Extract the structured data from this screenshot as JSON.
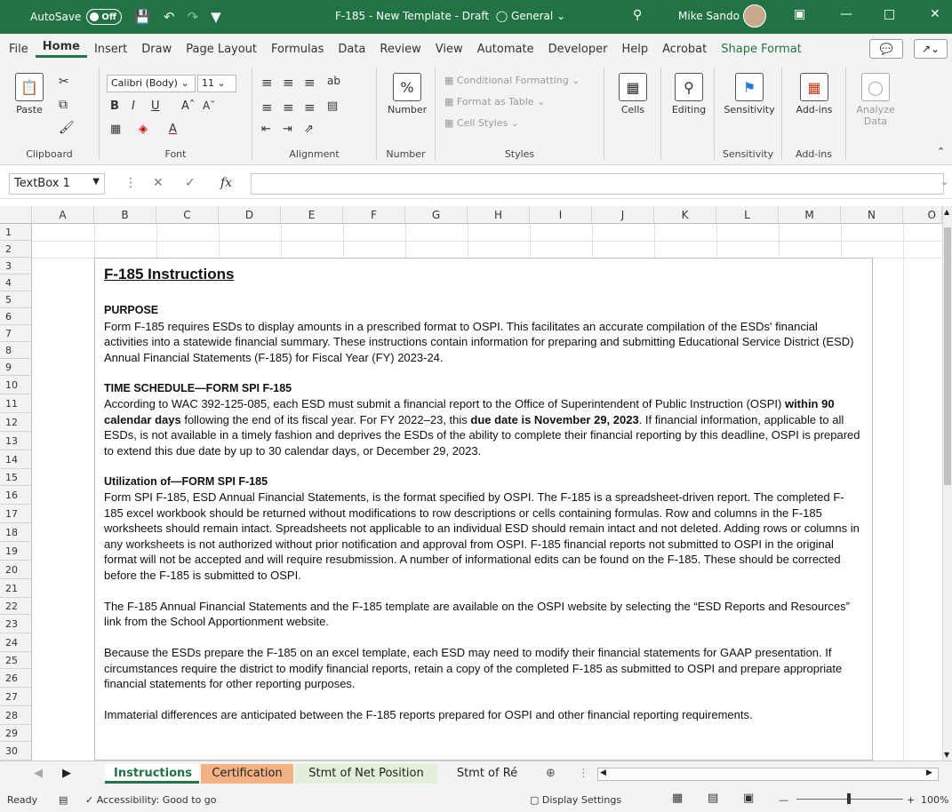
{
  "titlebar": {
    "autosave_label": "AutoSave",
    "autosave_state": "Off",
    "doc_title": "F-185 - New Template - Draft",
    "sensitivity": "General",
    "user": "Mike Sando"
  },
  "menu": {
    "tabs": [
      "File",
      "Home",
      "Insert",
      "Draw",
      "Page Layout",
      "Formulas",
      "Data",
      "Review",
      "View",
      "Automate",
      "Developer",
      "Help",
      "Acrobat",
      "Shape Format"
    ]
  },
  "ribbon": {
    "paste": "Paste",
    "clipboard": "Clipboard",
    "font_name": "Calibri (Body)",
    "font_size": "11",
    "font": "Font",
    "alignment": "Alignment",
    "number": "Number",
    "number_label": "Number",
    "conditional_formatting": "Conditional Formatting",
    "format_as_table": "Format as Table",
    "cell_styles": "Cell Styles",
    "styles": "Styles",
    "cells": "Cells",
    "editing": "Editing",
    "sensitivity": "Sensitivity",
    "sensitivity_group": "Sensitivity",
    "addins": "Add-ins",
    "addins_group": "Add-ins",
    "analyze_data": "Analyze Data"
  },
  "formula_bar": {
    "name_box": "TextBox 1",
    "fx": "fx"
  },
  "grid": {
    "columns": [
      "A",
      "B",
      "C",
      "D",
      "E",
      "F",
      "G",
      "H",
      "I",
      "J",
      "K",
      "L",
      "M",
      "N",
      "O"
    ],
    "rows": [
      "1",
      "2",
      "3",
      "4",
      "5",
      "6",
      "7",
      "8",
      "9",
      "10",
      "11",
      "12",
      "13",
      "14",
      "15",
      "16",
      "17",
      "18",
      "19",
      "20",
      "21",
      "22",
      "23",
      "24",
      "25",
      "26",
      "27",
      "28",
      "29",
      "30"
    ]
  },
  "textbox": {
    "title": "F-185 Instructions",
    "purpose_head": "PURPOSE",
    "purpose_body": "Form F-185 requires ESDs to display amounts in a prescribed format to OSPI. This facilitates an accurate compilation of the ESDs' financial activities into a statewide financial summary. These instructions contain information for preparing and submitting Educational Service District (ESD) Annual Financial Statements (F-185) for Fiscal Year (FY) 2023-24.",
    "schedule_head": "TIME SCHEDULE—FORM SPI F-185",
    "schedule_1": "According to WAC 392-125-085, each ESD must submit a financial report to the Office of Superintendent of Public Instruction (OSPI) ",
    "schedule_b1": "within 90 calendar days",
    "schedule_2": " following the end of its fiscal year. For FY 2022–23, this ",
    "schedule_b2": "due date is November 29, 2023",
    "schedule_3": ". If financial information, applicable to all ESDs, is not available in a timely fashion and deprives the ESDs of the ability to complete their financial reporting by this deadline, OSPI is prepared to extend this due date by up to 30 calendar days, or December 29, 2023.",
    "util_head": "Utilization of—FORM SPI F-185",
    "util_body": "Form SPI F-185, ESD Annual Financial Statements, is the format specified by OSPI. The F-185 is a spreadsheet-driven report. The completed F-185 excel workbook should be returned without modifications to row descriptions or cells containing formulas. Row and columns in the F-185 worksheets should remain intact. Spreadsheets not applicable to an individual ESD should remain intact and not deleted. Adding rows or columns in any worksheets is not authorized without prior notification and approval from OSPI. F-185 financial reports not submitted to OSPI in the original format will not be accepted and will require resubmission. A number of informational edits can be found on the F-185. These should be corrected before the F-185 is submitted to OSPI.",
    "para_website": "The F-185 Annual Financial Statements and the F-185 template are available on the OSPI website by selecting the “ESD Reports and Resources” link from the School Apportionment website.",
    "para_gaap": "Because the ESDs prepare the F-185 on an excel template, each ESD may need to modify their financial statements for GAAP presentation. If circumstances require the district to modify financial reports, retain a copy of the completed F-185 as submitted to OSPI and prepare appropriate financial statements for other reporting purposes.",
    "para_immaterial": "Immaterial differences are anticipated between the F-185 reports prepared for OSPI and other financial reporting requirements."
  },
  "sheets": [
    "Instructions",
    "Certification",
    "Stmt of Net Position",
    "Stmt of Ré ..."
  ],
  "status": {
    "ready": "Ready",
    "accessibility": "Accessibility: Good to go",
    "display_settings": "Display Settings",
    "zoom": "100%"
  },
  "colors": {
    "excel_green": "#217346",
    "tab_orange": "#f4b183",
    "tab_green": "#e2efda"
  }
}
